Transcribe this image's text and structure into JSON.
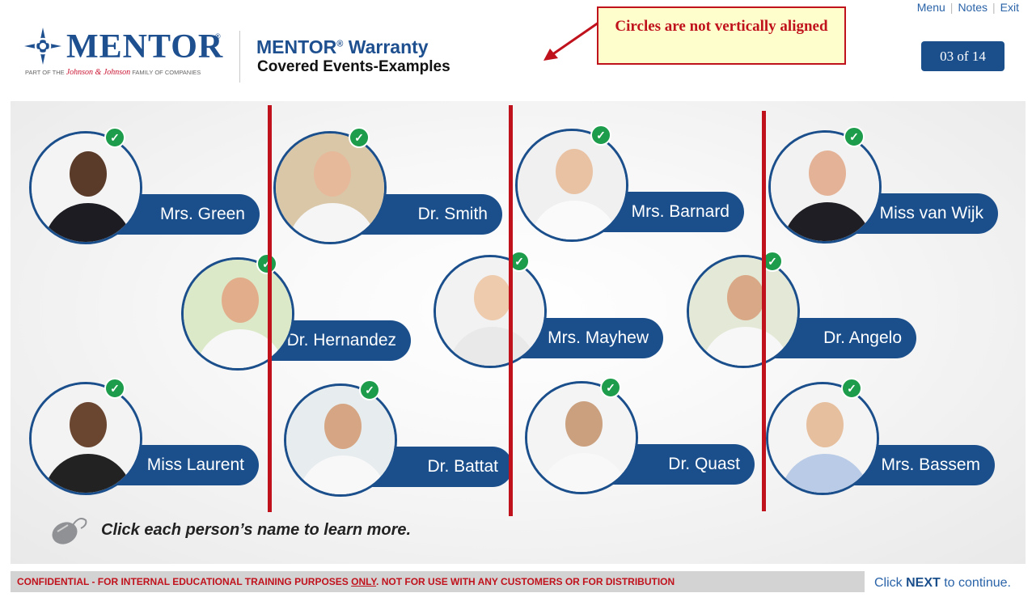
{
  "topnav": {
    "menu": "Menu",
    "notes": "Notes",
    "exit": "Exit",
    "separator": "|"
  },
  "logo": {
    "wordmark": "MENTOR",
    "registered": "®",
    "tagline_prefix": "PART OF THE",
    "tagline_brand": "Johnson & Johnson",
    "tagline_suffix": "FAMILY OF COMPANIES"
  },
  "header": {
    "title": "MENTOR",
    "title_sup": "®",
    "title_rest": " Warranty",
    "subtitle": "Covered Events-Examples"
  },
  "annotation": {
    "text": "Circles are not vertically aligned"
  },
  "page_badge": "03 of 14",
  "people": [
    {
      "name": "Mrs. Green",
      "checked": true
    },
    {
      "name": "Dr. Smith",
      "checked": true
    },
    {
      "name": "Mrs. Barnard",
      "checked": true
    },
    {
      "name": "Miss van Wijk",
      "checked": true
    },
    {
      "name": "Dr. Hernandez",
      "checked": true
    },
    {
      "name": "Mrs. Mayhew",
      "checked": true
    },
    {
      "name": "Dr. Angelo",
      "checked": true
    },
    {
      "name": "Miss Laurent",
      "checked": true
    },
    {
      "name": "Dr. Battat",
      "checked": true
    },
    {
      "name": "Dr. Quast",
      "checked": true
    },
    {
      "name": "Mrs. Bassem",
      "checked": true
    }
  ],
  "check_glyph": "✓",
  "hint": "Click each person’s name to learn more.",
  "footer": {
    "confidential_a": "CONFIDENTIAL - FOR INTERNAL EDUCATIONAL TRAINING PURPOSES ",
    "confidential_only": "ONLY",
    "confidential_b": ". NOT FOR USE WITH ANY CUSTOMERS OR FOR DISTRIBUTION",
    "next_a": "Click ",
    "next_b": "NEXT",
    "next_c": " to continue."
  },
  "colors": {
    "brand_blue": "#1b4f8c",
    "annotation_red": "#c0121c",
    "check_green": "#1d9c4b"
  }
}
